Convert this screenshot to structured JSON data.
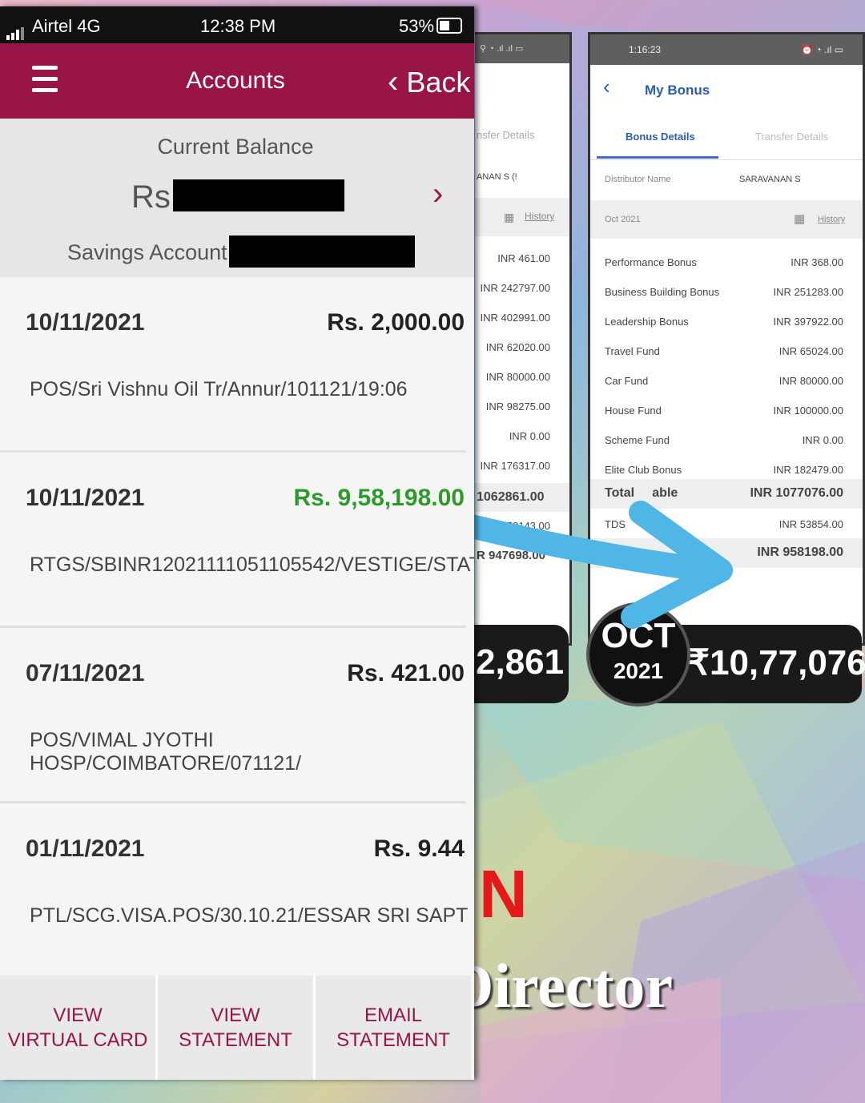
{
  "status_bar": {
    "carrier": "Airtel  4G",
    "time": "12:38 PM",
    "battery": "53%"
  },
  "header": {
    "title": "Accounts",
    "back_label": "Back"
  },
  "balance": {
    "label": "Current Balance",
    "currency": "Rs.",
    "account_label": "Savings Account -"
  },
  "transactions": [
    {
      "date": "10/11/2021",
      "amount": "Rs. 2,000.00",
      "description": "POS/Sri Vishnu Oil Tr/Annur/101121/19:06",
      "credit": false
    },
    {
      "date": "10/11/2021",
      "amount": "Rs. 9,58,198.00",
      "description": "RTGS/SBINR12021111051105542/VESTIGE/STAT",
      "credit": true
    },
    {
      "date": "07/11/2021",
      "amount": "Rs. 421.00",
      "description": "POS/VIMAL JYOTHI HOSP/COIMBATORE/071121/",
      "credit": false
    },
    {
      "date": "01/11/2021",
      "amount": "Rs. 9.44",
      "description": "PTL/SCG.VISA.POS/30.10.21/ESSAR SRI SAPT",
      "credit": false
    }
  ],
  "footer": [
    {
      "line1": "VIEW",
      "line2": "VIRTUAL CARD"
    },
    {
      "line1": "VIEW",
      "line2": "STATEMENT"
    },
    {
      "line1": "EMAIL",
      "line2": "STATEMENT"
    }
  ],
  "middle_phone": {
    "tab": "nsfer Details",
    "name": "ANAN S (!",
    "history": "History",
    "values": [
      "INR 461.00",
      "INR 242797.00",
      "INR 402991.00",
      "INR 62020.00",
      "INR 80000.00",
      "INR 98275.00",
      "INR 0.00",
      "INR 176317.00"
    ],
    "total": "1062861.00",
    "tds": "INR 53143.00",
    "net": "R 947698.00",
    "pill_value": "2,861"
  },
  "bonus_phone": {
    "time": "1:16:23",
    "title": "My Bonus",
    "tab_active": "Bonus Details",
    "tab_inactive": "Transfer Details",
    "distributor_label": "Distributor Name",
    "distributor_value": "SARAVANAN S",
    "month": "Oct 2021",
    "history": "History",
    "rows": [
      {
        "label": "Performance Bonus",
        "value": "INR 368.00"
      },
      {
        "label": "Business Building Bonus",
        "value": "INR 251283.00"
      },
      {
        "label": "Leadership Bonus",
        "value": "INR 397922.00"
      },
      {
        "label": "Travel Fund",
        "value": "INR 65024.00"
      },
      {
        "label": "Car Fund",
        "value": "INR 80000.00"
      },
      {
        "label": "House Fund",
        "value": "INR 100000.00"
      },
      {
        "label": "Scheme Fund",
        "value": "INR 0.00"
      },
      {
        "label": "Elite Club Bonus",
        "value": "INR 182479.00"
      }
    ],
    "total_label": "Total",
    "total_label_rest": "able",
    "total_value": "INR 1077076.00",
    "tds_label": "TDS",
    "tds_value": "INR 53854.00",
    "net_value": "INR 958198.00"
  },
  "overlay": {
    "month": "OCT",
    "year": "2021",
    "amount": "₹10,77,076",
    "red_letter": "N",
    "director_text": "Director"
  }
}
